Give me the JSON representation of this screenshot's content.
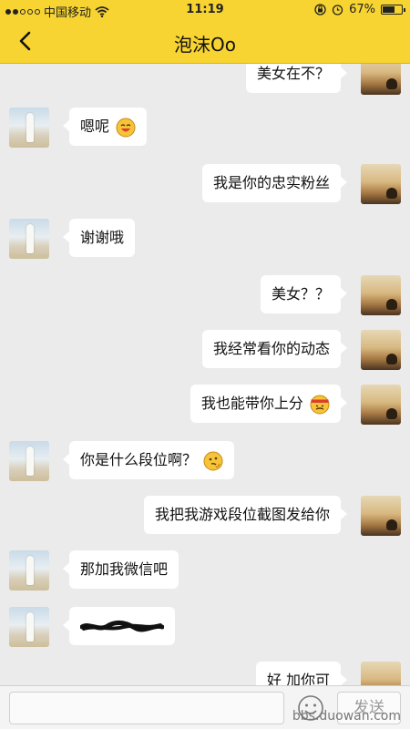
{
  "status_bar": {
    "carrier": "中国移动",
    "time": "11:19",
    "battery": "67%",
    "battery_level": 0.67,
    "signal_bars_filled": 2,
    "signal_bars_total": 5
  },
  "nav": {
    "title": "泡沫Oo"
  },
  "messages": [
    {
      "sender": "me",
      "text": "美女在不？"
    },
    {
      "sender": "her",
      "text": "嗯呢",
      "emoji": "grinning-emoji"
    },
    {
      "sender": "me",
      "text": "我是你的忠实粉丝"
    },
    {
      "sender": "her",
      "text": "谢谢哦"
    },
    {
      "sender": "me",
      "text": "美女？？"
    },
    {
      "sender": "me",
      "text": "我经常看你的动态"
    },
    {
      "sender": "me",
      "text": "我也能带你上分",
      "emoji": "headband-emoji"
    },
    {
      "sender": "her",
      "text": "你是什么段位啊？",
      "emoji": "thinking-emoji"
    },
    {
      "sender": "me",
      "text": "我把我游戏段位截图发给你"
    },
    {
      "sender": "her",
      "text": "那加我微信吧"
    },
    {
      "sender": "her",
      "text": "",
      "redacted": true
    },
    {
      "sender": "me",
      "text": "好 加你可"
    }
  ],
  "input": {
    "placeholder": "",
    "send_label": "发送"
  },
  "watermark": "bbs.duowan.com",
  "colors": {
    "header": "#f7d431",
    "background": "#ebebeb",
    "bubble": "#ffffff"
  }
}
